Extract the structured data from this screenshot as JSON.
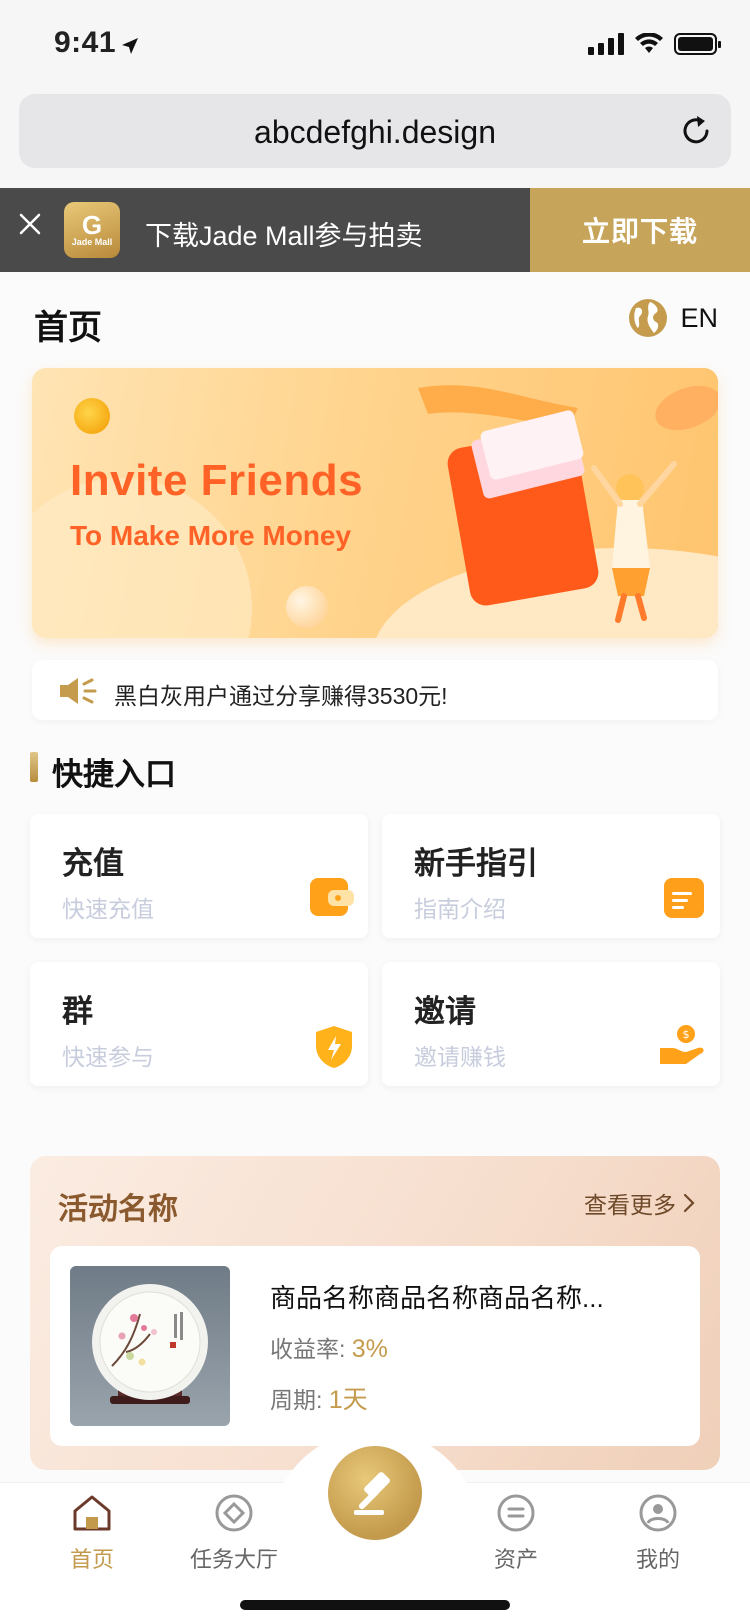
{
  "status_bar": {
    "time": "9:41"
  },
  "browser": {
    "url": "abcdefghi.design"
  },
  "download_banner": {
    "app_logo_letter": "G",
    "app_logo_text": "Jade Mall",
    "text": "下载Jade Mall参与拍卖",
    "button": "立即下载"
  },
  "header": {
    "title": "首页",
    "language": "EN"
  },
  "hero": {
    "headline": "Invite Friends",
    "subline": "To Make More Money"
  },
  "notice": {
    "text": "黑白灰用户通过分享赚得3530元!"
  },
  "quick_entry": {
    "title": "快捷入口",
    "items": [
      {
        "title": "充值",
        "subtitle": "快速充值",
        "icon": "wallet-icon"
      },
      {
        "title": "新手指引",
        "subtitle": "指南介绍",
        "icon": "guide-icon"
      },
      {
        "title": "群",
        "subtitle": "快速参与",
        "icon": "shield-bolt-icon"
      },
      {
        "title": "邀请",
        "subtitle": "邀请赚钱",
        "icon": "hand-coin-icon"
      }
    ]
  },
  "activity": {
    "title": "活动名称",
    "more": "查看更多",
    "product": {
      "name": "商品名称商品名称商品名称...",
      "yield_label": "收益率:",
      "yield_value": "3%",
      "period_label": "周期:",
      "period_value": "1天"
    }
  },
  "tabbar": {
    "tabs": [
      {
        "label": "首页",
        "active": true
      },
      {
        "label": "任务大厅",
        "active": false
      },
      {
        "label": "资产",
        "active": false
      },
      {
        "label": "我的",
        "active": false
      }
    ]
  },
  "colors": {
    "gold": "#c6a45a",
    "accent_orange": "#ff6226",
    "banner_bg": "#4a4a4a"
  }
}
